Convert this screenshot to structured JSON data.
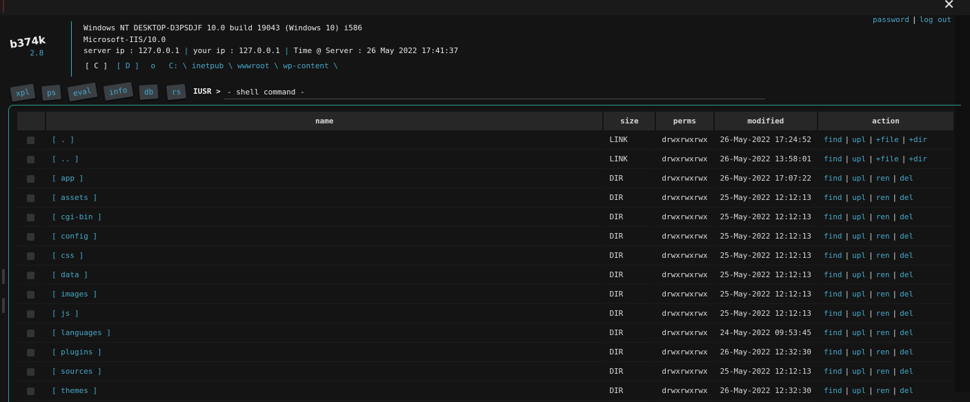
{
  "system": {
    "os": "Windows NT DESKTOP-D3PSDJF 10.0 build 19043 (Windows 10) i586",
    "server_software": "Microsoft-IIS/10.0",
    "server_ip_text": "server ip : 127.0.0.1",
    "your_ip_text": "your ip : 127.0.0.1",
    "time_text": "Time @ Server : 26 May 2022 17:41:37"
  },
  "logo": {
    "name": "b374k",
    "version": "2.8"
  },
  "nav": {
    "drive_c": "[ C ]",
    "drive_d": "[ D ]",
    "refresh": "o",
    "path": [
      "C:",
      "inetpub",
      "wwwroot",
      "wp-content"
    ],
    "path_sep": "\\"
  },
  "top_links": {
    "password": "password",
    "logout": "log out"
  },
  "tabs": [
    "xpl",
    "ps",
    "eval",
    "info",
    "db",
    "rs"
  ],
  "shell": {
    "user": "IUSR >",
    "placeholder": "- shell command -"
  },
  "table": {
    "headers": {
      "name": "name",
      "size": "size",
      "perms": "perms",
      "modified": "modified",
      "action": "action"
    },
    "rows": [
      {
        "name": "[ . ]",
        "size": "LINK",
        "perms": "drwxrwxrwx",
        "modified": "26-May-2022 17:24:52",
        "actions": [
          "find",
          "upl",
          "+file",
          "+dir"
        ]
      },
      {
        "name": "[ .. ]",
        "size": "LINK",
        "perms": "drwxrwxrwx",
        "modified": "26-May-2022 13:58:01",
        "actions": [
          "find",
          "upl",
          "+file",
          "+dir"
        ]
      },
      {
        "name": "[ app ]",
        "size": "DIR",
        "perms": "drwxrwxrwx",
        "modified": "26-May-2022 17:07:22",
        "actions": [
          "find",
          "upl",
          "ren",
          "del"
        ]
      },
      {
        "name": "[ assets ]",
        "size": "DIR",
        "perms": "drwxrwxrwx",
        "modified": "25-May-2022 12:12:13",
        "actions": [
          "find",
          "upl",
          "ren",
          "del"
        ]
      },
      {
        "name": "[ cgi-bin ]",
        "size": "DIR",
        "perms": "drwxrwxrwx",
        "modified": "25-May-2022 12:12:13",
        "actions": [
          "find",
          "upl",
          "ren",
          "del"
        ]
      },
      {
        "name": "[ config ]",
        "size": "DIR",
        "perms": "drwxrwxrwx",
        "modified": "25-May-2022 12:12:13",
        "actions": [
          "find",
          "upl",
          "ren",
          "del"
        ]
      },
      {
        "name": "[ css ]",
        "size": "DIR",
        "perms": "drwxrwxrwx",
        "modified": "25-May-2022 12:12:13",
        "actions": [
          "find",
          "upl",
          "ren",
          "del"
        ]
      },
      {
        "name": "[ data ]",
        "size": "DIR",
        "perms": "drwxrwxrwx",
        "modified": "25-May-2022 12:12:13",
        "actions": [
          "find",
          "upl",
          "ren",
          "del"
        ]
      },
      {
        "name": "[ images ]",
        "size": "DIR",
        "perms": "drwxrwxrwx",
        "modified": "25-May-2022 12:12:13",
        "actions": [
          "find",
          "upl",
          "ren",
          "del"
        ]
      },
      {
        "name": "[ js ]",
        "size": "DIR",
        "perms": "drwxrwxrwx",
        "modified": "25-May-2022 12:12:13",
        "actions": [
          "find",
          "upl",
          "ren",
          "del"
        ]
      },
      {
        "name": "[ languages ]",
        "size": "DIR",
        "perms": "drwxrwxrwx",
        "modified": "24-May-2022 09:53:45",
        "actions": [
          "find",
          "upl",
          "ren",
          "del"
        ]
      },
      {
        "name": "[ plugins ]",
        "size": "DIR",
        "perms": "drwxrwxrwx",
        "modified": "26-May-2022 12:32:30",
        "actions": [
          "find",
          "upl",
          "ren",
          "del"
        ]
      },
      {
        "name": "[ sources ]",
        "size": "DIR",
        "perms": "drwxrwxrwx",
        "modified": "25-May-2022 12:12:13",
        "actions": [
          "find",
          "upl",
          "ren",
          "del"
        ]
      },
      {
        "name": "[ themes ]",
        "size": "DIR",
        "perms": "drwxrwxrwx",
        "modified": "26-May-2022 12:32:30",
        "actions": [
          "find",
          "upl",
          "ren",
          "del"
        ]
      }
    ]
  },
  "colors": {
    "accent": "#46a8c8",
    "frame": "#2a9c8f",
    "background": "#141414",
    "header_bg": "#272727"
  },
  "icons": {
    "close": "close-icon",
    "checkbox": "checkbox-icon"
  }
}
